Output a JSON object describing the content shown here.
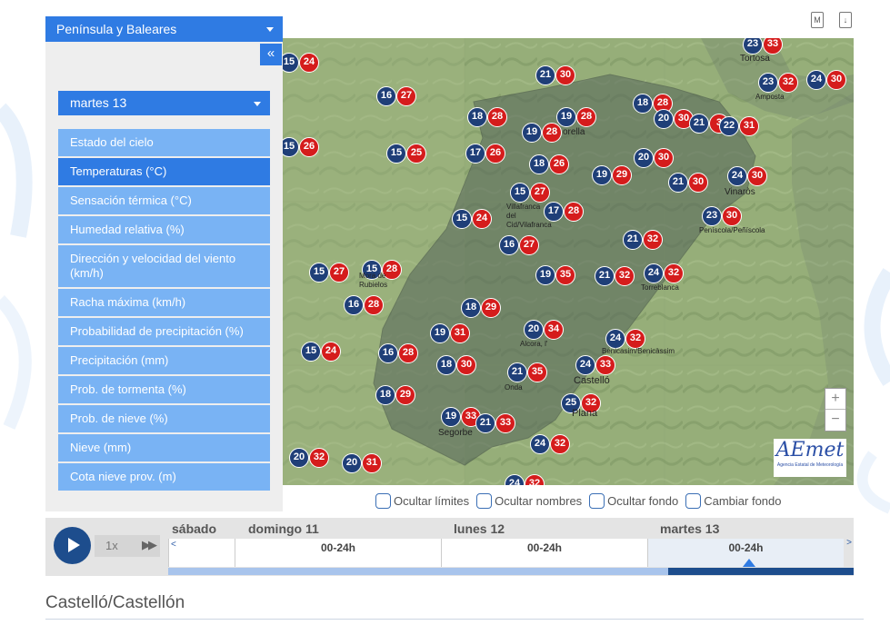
{
  "region_select": "Península y Baleares",
  "collapse_label": "«",
  "day_select": "martes 13",
  "menu": [
    {
      "label": "Estado del cielo",
      "active": false
    },
    {
      "label": "Temperaturas (°C)",
      "active": true
    },
    {
      "label": "Sensación térmica (°C)",
      "active": false
    },
    {
      "label": "Humedad relativa (%)",
      "active": false
    },
    {
      "label": "Dirección y velocidad del viento (km/h)",
      "active": false
    },
    {
      "label": "Racha máxima (km/h)",
      "active": false
    },
    {
      "label": "Probabilidad de precipitación (%)",
      "active": false
    },
    {
      "label": "Precipitación (mm)",
      "active": false
    },
    {
      "label": "Prob. de tormenta (%)",
      "active": false
    },
    {
      "label": "Prob. de nieve (%)",
      "active": false
    },
    {
      "label": "Nieve (mm)",
      "active": false
    },
    {
      "label": "Cota nieve prov. (m)",
      "active": false
    }
  ],
  "map_icons": [
    "M",
    "↓"
  ],
  "map": {
    "stations": [
      {
        "min": "23",
        "max": "33"
      },
      {
        "min": "15",
        "max": "24"
      },
      {
        "min": "21",
        "max": "30"
      },
      {
        "min": "16",
        "max": "27"
      },
      {
        "min": "18",
        "max": "28"
      },
      {
        "min": "19",
        "max": "28"
      },
      {
        "min": "18",
        "max": "28"
      },
      {
        "min": "23",
        "max": "32"
      },
      {
        "min": "24",
        "max": "30"
      },
      {
        "min": "20",
        "max": "30"
      },
      {
        "min": "21",
        "max": "3"
      },
      {
        "min": "22",
        "max": "31"
      },
      {
        "min": "19",
        "max": "28"
      },
      {
        "min": "15",
        "max": "26"
      },
      {
        "min": "15",
        "max": "25"
      },
      {
        "min": "17",
        "max": "26"
      },
      {
        "min": "18",
        "max": "26"
      },
      {
        "min": "19",
        "max": "29"
      },
      {
        "min": "20",
        "max": "30"
      },
      {
        "min": "24",
        "max": "30"
      },
      {
        "min": "15",
        "max": "27"
      },
      {
        "min": "21",
        "max": "30"
      },
      {
        "min": "17",
        "max": "28"
      },
      {
        "min": "15",
        "max": "24"
      },
      {
        "min": "23",
        "max": "30"
      },
      {
        "min": "16",
        "max": "27"
      },
      {
        "min": "21",
        "max": "32"
      },
      {
        "min": "15",
        "max": "28"
      },
      {
        "min": "15",
        "max": "27"
      },
      {
        "min": "19",
        "max": "35"
      },
      {
        "min": "21",
        "max": "32"
      },
      {
        "min": "24",
        "max": "32"
      },
      {
        "min": "16",
        "max": "28"
      },
      {
        "min": "18",
        "max": "29"
      },
      {
        "min": "20",
        "max": "34"
      },
      {
        "min": "19",
        "max": "31"
      },
      {
        "min": "24",
        "max": "32"
      },
      {
        "min": "15",
        "max": "24"
      },
      {
        "min": "16",
        "max": "28"
      },
      {
        "min": "18",
        "max": "30"
      },
      {
        "min": "21",
        "max": "35"
      },
      {
        "min": "24",
        "max": "33"
      },
      {
        "min": "18",
        "max": "29"
      },
      {
        "min": "25",
        "max": "32"
      },
      {
        "min": "19",
        "max": "33"
      },
      {
        "min": "21",
        "max": "33"
      },
      {
        "min": "24",
        "max": "32"
      },
      {
        "min": "20",
        "max": "32"
      },
      {
        "min": "20",
        "max": "31"
      },
      {
        "min": "24",
        "max": "32"
      }
    ],
    "towns": {
      "tortosa": "Tortosa",
      "amposta": "Amposta",
      "morella": "orella",
      "vinaros": "Vinaròs",
      "villafranca": "Villafranca\ndel\nCid/Vilafranca",
      "peniscola": "Peníscola/Peñíscola",
      "mora": "Mora de\nRubielos",
      "torreblanca": "Torreblanca",
      "alcora": "Alcora, l'",
      "benicasim": "Benicasim/Benicàssim",
      "castello": "Castelló",
      "onda": "Onda",
      "plana": "Plana",
      "segorbe": "Segorbe"
    },
    "zoom_in": "+",
    "zoom_out": "−",
    "logo_text": "AEmet",
    "logo_sub": "Agencia Estatal de Meteorología"
  },
  "checkboxes": [
    "Ocultar límites",
    "Ocultar nombres",
    "Ocultar fondo",
    "Cambiar fondo"
  ],
  "timeline": {
    "speed": "1x",
    "ff": "▶▶",
    "days": [
      "sábado 10",
      "domingo 11",
      "lunes 12",
      "martes 13"
    ],
    "slot_label": "00-24h",
    "prev": "<",
    "next": ">",
    "progress": 0.73
  },
  "station_title": "Castelló/Castellón"
}
